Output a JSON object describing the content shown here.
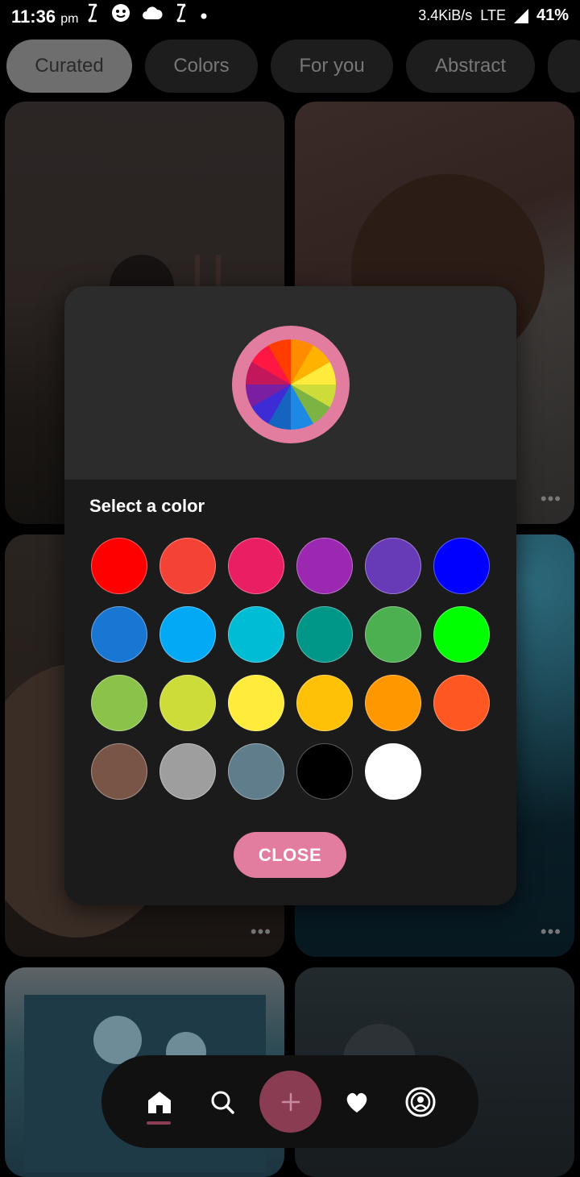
{
  "status_bar": {
    "time": "11:36",
    "time_suffix": "pm",
    "left_icons": [
      "s-app-icon",
      "smiley-icon",
      "cloud-icon",
      "s-app-icon",
      "dot-icon"
    ],
    "network_speed": "3.4KiB/s",
    "network_type": "LTE",
    "battery": "41%"
  },
  "categories": {
    "items": [
      {
        "label": "Curated",
        "active": true
      },
      {
        "label": "Colors",
        "active": false
      },
      {
        "label": "For you",
        "active": false
      },
      {
        "label": "Abstract",
        "active": false
      },
      {
        "label": "",
        "active": false
      }
    ]
  },
  "grid": {
    "more_label": "•••"
  },
  "color_picker": {
    "title": "Select a color",
    "close_label": "CLOSE",
    "swatches": [
      "#ff0000",
      "#f44336",
      "#e91e63",
      "#9c27b0",
      "#673ab7",
      "#0000ff",
      "#1976d2",
      "#03a9f4",
      "#00bcd4",
      "#009688",
      "#4caf50",
      "#00ff00",
      "#8bc34a",
      "#cddc39",
      "#ffeb3b",
      "#ffc107",
      "#ff9800",
      "#ff5722",
      "#795548",
      "#9e9e9e",
      "#607d8b",
      "#000000",
      "#ffffff"
    ]
  },
  "bottom_nav": {
    "items": [
      "home-icon",
      "search-icon",
      "add-icon",
      "heart-icon",
      "profile-icon"
    ],
    "active": "home-icon",
    "accent": "#8a3c53"
  }
}
